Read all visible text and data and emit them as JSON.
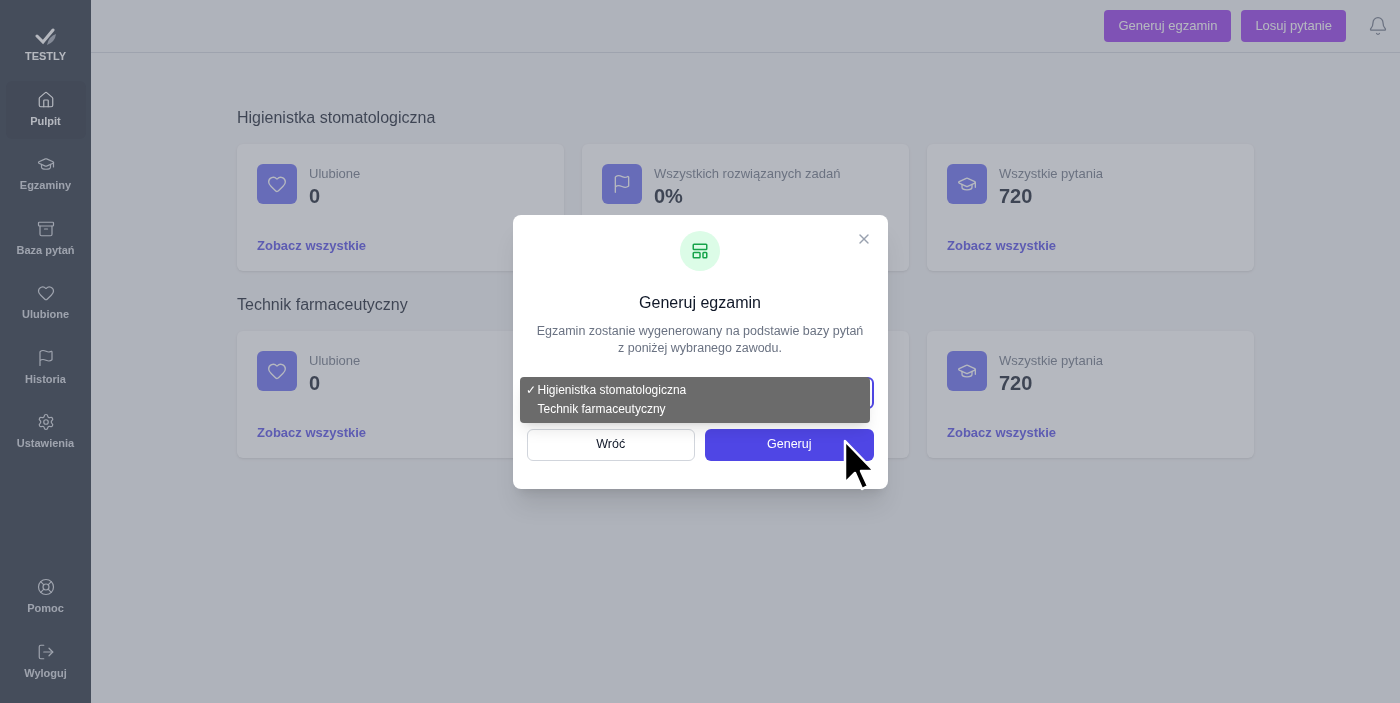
{
  "brand": "TESTLY",
  "nav": [
    {
      "label": "Pulpit",
      "selected": true
    },
    {
      "label": "Egzaminy",
      "selected": false
    },
    {
      "label": "Baza pytań",
      "selected": false
    },
    {
      "label": "Ulubione",
      "selected": false
    },
    {
      "label": "Historia",
      "selected": false
    },
    {
      "label": "Ustawienia",
      "selected": false
    }
  ],
  "nav_bottom": [
    {
      "label": "Pomoc"
    },
    {
      "label": "Wyloguj"
    }
  ],
  "header_buttons": [
    "Generuj egzamin",
    "Losuj pytanie"
  ],
  "sections": [
    {
      "title": "Higienistka stomatologiczna",
      "cards": [
        {
          "kind": "stat",
          "label": "Ulubione",
          "value": "0",
          "link": "Zobacz wszystkie"
        },
        {
          "kind": "stat",
          "label": "Wszystkich rozwiązanych zadań",
          "value": "0%"
        },
        {
          "kind": "stat",
          "label": "Wszystkie pytania",
          "value": "720",
          "link": "Zobacz wszystkie"
        }
      ]
    },
    {
      "title": "Technik farmaceutyczny",
      "cards": [
        {
          "kind": "stat",
          "label": "Ulubione",
          "value": "0",
          "link": "Zobacz wszystkie"
        },
        {
          "kind": "covered"
        },
        {
          "kind": "stat",
          "label": "Wszystkie pytania",
          "value": "720",
          "link": "Zobacz wszystkie"
        }
      ]
    }
  ],
  "modal": {
    "title": "Generuj egzamin",
    "description": "Egzamin zostanie wygenerowany na podstawie bazy pytań z poniżej wybranego zawodu.",
    "check_mark": "✓",
    "options": [
      {
        "label": "Higienistka stomatologiczna",
        "selected": true
      },
      {
        "label": "Technik farmaceutyczny",
        "selected": false
      }
    ],
    "cancel": "Wróć",
    "confirm": "Generuj"
  }
}
